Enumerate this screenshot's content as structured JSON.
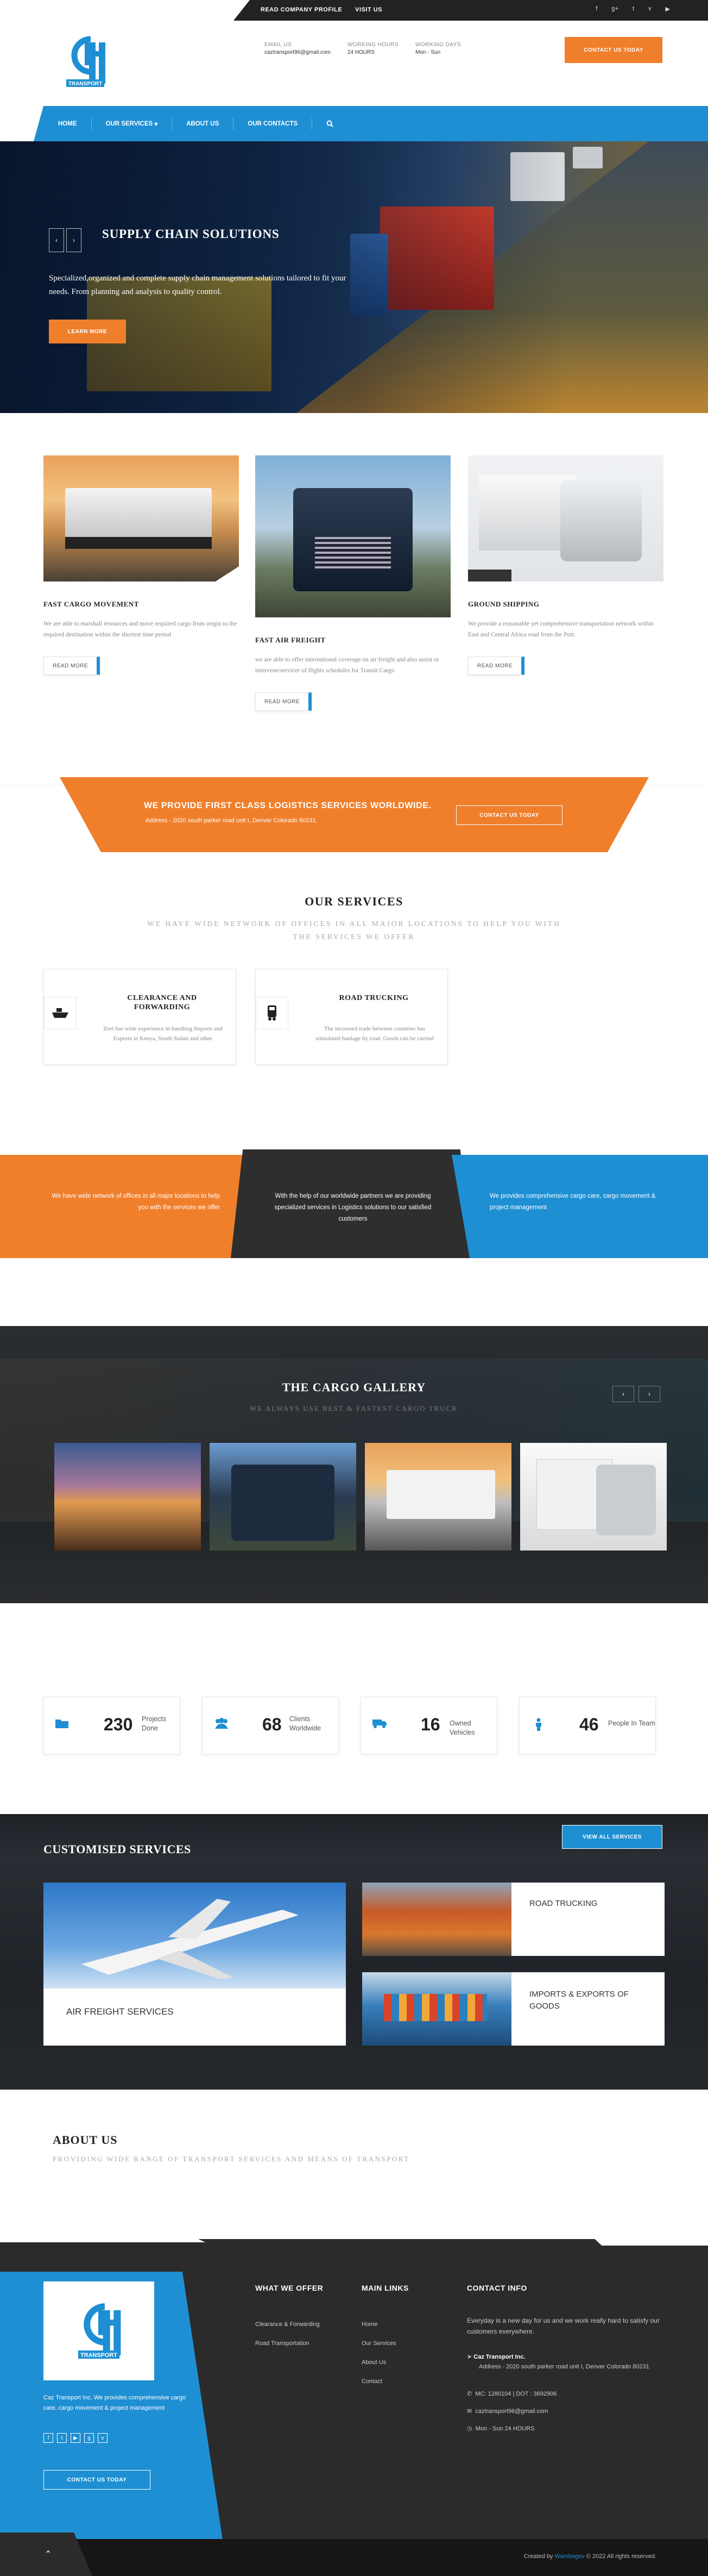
{
  "topbar": {
    "links": [
      "READ COMPANY PROFILE",
      "VISIT US"
    ],
    "social_icons": [
      "facebook-icon",
      "google-plus-icon",
      "twitter-icon",
      "vimeo-icon",
      "youtube-icon"
    ]
  },
  "header": {
    "email_label": "EMAIL US",
    "email_value": "caztransport96@gmail.com",
    "hours_label": "WORKING HOURS",
    "hours_value": "24 HOURS",
    "days_label": "WORKING DAYS",
    "days_value": "Mon - Sun",
    "cta": "CONTACT US TODAY"
  },
  "nav": {
    "items": [
      "HOME",
      "OUR SERVICES",
      "ABOUT US",
      "OUR CONTACTS"
    ],
    "services_caret": "▾",
    "search_icon": "search-icon"
  },
  "hero": {
    "title": "SUPPLY CHAIN SOLUTIONS",
    "text": "Specialized,organized and complete supply chain management solutions tailored to fit your needs. From planning and analysis to quality control.",
    "button": "LEARN MORE",
    "prev": "‹",
    "next": "›"
  },
  "cards": [
    {
      "title": "FAST CARGO MOVEMENT",
      "text": "We are able to marshall resources and move required cargo from origin to the required destination within the shortest time period",
      "button": "READ MORE"
    },
    {
      "title": "FAST AIR FREIGHT",
      "text": "we are able to offer international coverage on air freight and also assist or intervene/servicer of flights schedules for Transit Cargo",
      "button": "READ MORE"
    },
    {
      "title": "GROUND SHIPPING",
      "text": "We provide a reasonable yet comprehensive transportation network within East and Central Africa road from the Port.",
      "button": "READ MORE"
    }
  ],
  "banner": {
    "title": "WE PROVIDE FIRST CLASS LOGISTICS SERVICES WORLDWIDE.",
    "address": "Address - 2020 south parker road unit I, Denver Colorado 80231.",
    "button": "CONTACT US TODAY"
  },
  "services": {
    "title": "OUR SERVICES",
    "subtitle": "WE HAVE WIDE NETWORK OF OFFICES IN ALL MAJOR LOCATIONS TO HELP YOU WITH THE SERVICES WE OFFER",
    "items": [
      {
        "title": "CLEARANCE AND FORWARDING",
        "text": "Zeel has wide experience in handling Imports and Exports in Kenya, South Sudan and other",
        "icon": "ship-icon"
      },
      {
        "title": "ROAD TRUCKING",
        "text": "The increased trade between countries has stimulated haulage by road. Goods can be carried",
        "icon": "truck-icon"
      }
    ]
  },
  "strips": [
    "We have wide network of offices in all major locations to help you with the services we offer",
    "With the help of our worldwide partners we are providing specialized services in Logistics solutions to our satisfied customers",
    "We provides comprehensive cargo care, cargo movement & project management"
  ],
  "gallery": {
    "title": "THE CARGO GALLERY",
    "subtitle": "WE ALWAYS USE BEST & FASTEST CARGO TRUCK",
    "prev": "‹",
    "next": "›"
  },
  "counters": [
    {
      "value": "230",
      "label": "Projects Done",
      "icon": "folder-icon"
    },
    {
      "value": "68",
      "label": "Clients Worldwide",
      "icon": "users-icon"
    },
    {
      "value": "16",
      "label": "Owned Vehicles",
      "icon": "truck-icon"
    },
    {
      "value": "46",
      "label": "People In Team",
      "icon": "person-icon"
    }
  ],
  "customised": {
    "title": "CUSTOMISED SERVICES",
    "button": "VIEW ALL SERVICES",
    "items": [
      "AIR FREIGHT SERVICES",
      "ROAD TRUCKING",
      "IMPORTS & EXPORTS OF GOODS"
    ]
  },
  "about": {
    "title": "ABOUT US",
    "subtitle": "PROVIDING WIDE RANGE OF TRANSPORT SERVICES AND MEANS OF TRANSPORT"
  },
  "footer": {
    "about_text": "Caz Transport Inc. We provides comprehensive cargo care, cargo movement & project management",
    "contact_button": "CONTACT US TODAY",
    "offer_title": "WHAT WE OFFER",
    "offer_items": [
      "Clearance & Forwarding",
      "Road Transportation"
    ],
    "links_title": "MAIN LINKS",
    "links_items": [
      "Home",
      "Our Services",
      "About Us",
      "Contact"
    ],
    "contact_title": "CONTACT INFO",
    "contact_intro": "Everyday is a new day for us and we work really hard to satisfy our customers everywhere.",
    "company": "Caz Transport Inc.",
    "address": "Address - 2020 south parker road unit I, Denver Colorado 80231",
    "phone": "MC: 1280104 | DOT : 3692906",
    "email": "caztransport96@gmail.com",
    "hours": "Mon - Sun 24 HOURS",
    "copyright_prefix": "Created by",
    "copyright_author": "Wambogov",
    "copyright_suffix": "© 2022 All rights reserved.",
    "top_arrow": "⌃"
  },
  "colors": {
    "orange": "#f07f2c",
    "blue": "#1f8fd3",
    "dark": "#2b2b2b"
  }
}
